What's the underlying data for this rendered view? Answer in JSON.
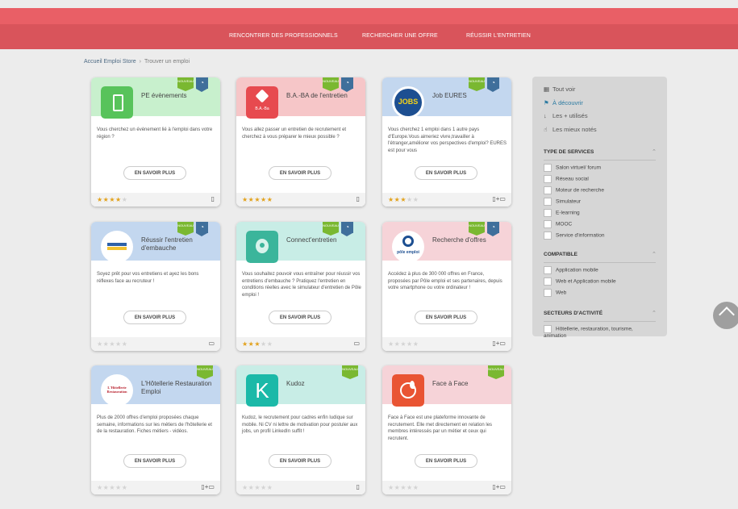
{
  "nav": {
    "items": [
      "RENCONTRER DES PROFESSIONNELS",
      "RECHERCHER UNE OFFRE",
      "RÉUSSIR L'ENTRETIEN"
    ]
  },
  "breadcrumb": {
    "home": "Accueil Emploi Store",
    "sep": "›",
    "current": "Trouver un emploi"
  },
  "common": {
    "button_label": "EN SAVOIR PLUS",
    "new_label": "NOUVEAU",
    "badge_icon": "clock-icon"
  },
  "colors": {
    "new_ribbon": "#7ab831",
    "badge": "#3f6f9b",
    "star": "#e2a21d",
    "header": "#e95f66"
  },
  "cards": [
    {
      "title": "PE évènements",
      "desc": "Vous cherchez un évènement lié à l'emploi dans votre région ?",
      "rating": 3.5,
      "devices": "▯",
      "bg": "#c8f0cd",
      "logo": "phone-logo",
      "new": true,
      "badge": true
    },
    {
      "title": "B.A.-BA de l'entretien",
      "desc": "Vous allez passer un entretien de recrutement et cherchez à vous préparer le mieux possible ?",
      "rating": 4.5,
      "devices": "▯",
      "bg": "#f6c6c8",
      "logo": "baba-logo",
      "logo_text": "B.A.-Ba",
      "new": true,
      "badge": true
    },
    {
      "title": "Job EURES",
      "desc": "Vous cherchez 1 emploi dans 1 autre pays d'Europe.Vous aimeriez vivre,travailler à l'étranger,améliorer vos perspectives d'emploi? EURES est pour vous",
      "rating": 3,
      "devices": "▯+▭",
      "bg": "#c3d7ef",
      "logo": "eures-logo",
      "logo_text": "JOBS",
      "new": true,
      "badge": true
    },
    {
      "title": "Réussir l'entretien d'embauche",
      "desc": "Soyez prêt pour vos entretiens et ayez les bons réflexes face au recruteur !",
      "rating": 0,
      "devices": "▭",
      "bg": "#c3d7ef",
      "logo": "reussir-logo",
      "new": true,
      "badge": true
    },
    {
      "title": "Connect'entretien",
      "desc": "Vous souhaitez pouvoir vous entraîner pour réussir vos entretiens d'embauche ? Pratiquez l'entretien en conditions réelles avec le simulateur d'entretien de Pôle emploi !",
      "rating": 3,
      "devices": "▭",
      "bg": "#c8ede6",
      "logo": "connect-logo",
      "new": true,
      "badge": true
    },
    {
      "title": "Recherche d'offres",
      "desc": "Accédez à plus de 300 000 offres en France, proposées par Pôle emploi et ses partenaires, depuis votre smartphone ou votre ordinateur !",
      "rating": 0,
      "devices": "▯+▭",
      "bg": "#f6d3d8",
      "logo": "pole-emploi-logo",
      "logo_text": "pôle emploi",
      "new": true,
      "badge": true
    },
    {
      "title": "L'Hôtellerie Restauration Emploi",
      "desc": "Plus de 2000 offres d'emploi proposées chaque semaine, informations sur les métiers de l'hôtellerie et de la restauration. Fiches métiers - vidéos.",
      "rating": 0,
      "devices": "▯+▭",
      "bg": "#c3d7ef",
      "logo": "hotellerie-logo",
      "logo_text": "L'Hôtellerie Restauration",
      "new": true,
      "badge": false
    },
    {
      "title": "Kudoz",
      "desc": "Kudoz, le recrutement pour cadres enfin ludique sur mobile. Ni CV ni lettre de motivation pour postuler aux jobs, un profil LinkedIn suffit !",
      "rating": 0,
      "devices": "▯",
      "bg": "#c8ede6",
      "logo": "kudoz-logo",
      "logo_text": "K",
      "new": true,
      "badge": false
    },
    {
      "title": "Face à Face",
      "desc": "Face à Face est une plateforme innovante de recrutement. Elle met directement en relation les membres intéressés par un métier et ceux qui recrutent.",
      "rating": 0,
      "devices": "▯+▭",
      "bg": "#f6d3d8",
      "logo": "face-logo",
      "new": true,
      "badge": false
    }
  ],
  "sidebar": {
    "links": [
      {
        "icon": "▦",
        "icon_name": "grid-icon",
        "label": "Tout voir",
        "active": false
      },
      {
        "icon": "⚑",
        "icon_name": "flag-icon",
        "label": "À découvrir",
        "active": true
      },
      {
        "icon": "↓",
        "icon_name": "sort-icon",
        "label": "Les + utilisés",
        "active": false
      },
      {
        "icon": "☝",
        "icon_name": "thumb-icon",
        "label": "Les mieux notés",
        "active": false
      }
    ],
    "sections": [
      {
        "title": "TYPE DE SERVICES",
        "options": [
          "Salon virtuel/ forum",
          "Réseau social",
          "Moteur de recherche",
          "Simulateur",
          "E-learning",
          "MOOC",
          "Service d'information"
        ]
      },
      {
        "title": "COMPATIBLE",
        "options": [
          "Application mobile",
          "Web et Application mobile",
          "Web"
        ]
      },
      {
        "title": "SECTEURS D'ACTIVITÉ",
        "options": [
          "Hôtellerie, restauration, tourisme, animation"
        ]
      }
    ]
  }
}
